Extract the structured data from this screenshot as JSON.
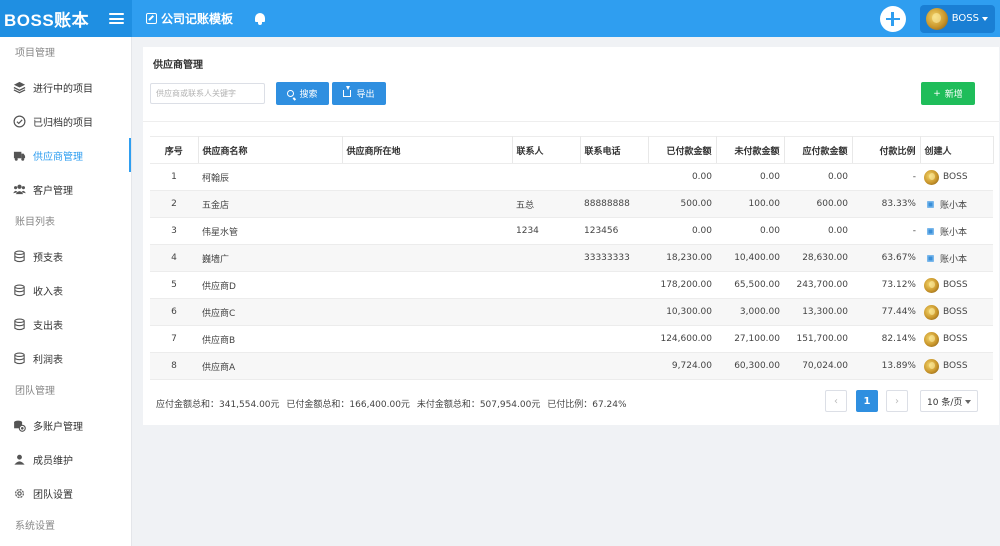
{
  "app": {
    "brand": "BOSS账本",
    "breadcrumb": "公司记账模板",
    "user_name": "BOSS"
  },
  "sidebar": {
    "sections": [
      {
        "label": "项目管理"
      },
      {
        "label": "账目列表"
      },
      {
        "label": "团队管理"
      },
      {
        "label": "系统设置"
      }
    ],
    "items": [
      {
        "label": "进行中的项目",
        "icon": "layers-icon"
      },
      {
        "label": "已归档的项目",
        "icon": "check-circle-icon"
      },
      {
        "label": "供应商管理",
        "icon": "truck-icon",
        "active": true
      },
      {
        "label": "客户管理",
        "icon": "users-icon"
      },
      {
        "label": "预支表",
        "icon": "database-icon"
      },
      {
        "label": "收入表",
        "icon": "database-icon"
      },
      {
        "label": "支出表",
        "icon": "database-icon"
      },
      {
        "label": "利润表",
        "icon": "database-icon"
      },
      {
        "label": "多账户管理",
        "icon": "coins-icon"
      },
      {
        "label": "成员维护",
        "icon": "user-icon"
      },
      {
        "label": "团队设置",
        "icon": "gear-icon"
      }
    ]
  },
  "main": {
    "title": "供应商管理",
    "search": {
      "placeholder": "供应商或联系人关键字",
      "value": ""
    },
    "buttons": {
      "search": "搜索",
      "export": "导出",
      "add": "新增"
    },
    "table": {
      "headers": [
        "序号",
        "供应商名称",
        "供应商所在地",
        "联系人",
        "联系电话",
        "已付款金额",
        "未付款金额",
        "应付款金额",
        "付款比例",
        "创建人"
      ],
      "rows": [
        [
          "1",
          "柯翰辰",
          "",
          "",
          "",
          "0.00",
          "0.00",
          "0.00",
          "-",
          "BOSS"
        ],
        [
          "2",
          "五金店",
          "",
          "五总",
          "88888888",
          "500.00",
          "100.00",
          "600.00",
          "83.33%",
          "账小本"
        ],
        [
          "3",
          "伟星水管",
          "",
          "1234",
          "123456",
          "0.00",
          "0.00",
          "0.00",
          "-",
          "账小本"
        ],
        [
          "4",
          "巍墙广",
          "",
          "",
          "33333333",
          "18,230.00",
          "10,400.00",
          "28,630.00",
          "63.67%",
          "账小本"
        ],
        [
          "5",
          "供应商D",
          "",
          "",
          "",
          "178,200.00",
          "65,500.00",
          "243,700.00",
          "73.12%",
          "BOSS"
        ],
        [
          "6",
          "供应商C",
          "",
          "",
          "",
          "10,300.00",
          "3,000.00",
          "13,300.00",
          "77.44%",
          "BOSS"
        ],
        [
          "7",
          "供应商B",
          "",
          "",
          "",
          "124,600.00",
          "27,100.00",
          "151,700.00",
          "82.14%",
          "BOSS"
        ],
        [
          "8",
          "供应商A",
          "",
          "",
          "",
          "9,724.00",
          "60,300.00",
          "70,024.00",
          "13.89%",
          "BOSS"
        ]
      ]
    },
    "summary": {
      "payable_total": "应付金额总和：341,554.00元",
      "paid_total": "已付金额总和：166,400.00元",
      "unpaid_total": "未付金额总和：507,954.00元",
      "paid_ratio": "已付比例：67.24%"
    },
    "pagination": {
      "prev": "‹",
      "current_page": "1",
      "next": "›",
      "page_size": "10 条/页"
    }
  },
  "colors": {
    "primary": "#2f9ef0",
    "success": "#1fbd5a"
  }
}
